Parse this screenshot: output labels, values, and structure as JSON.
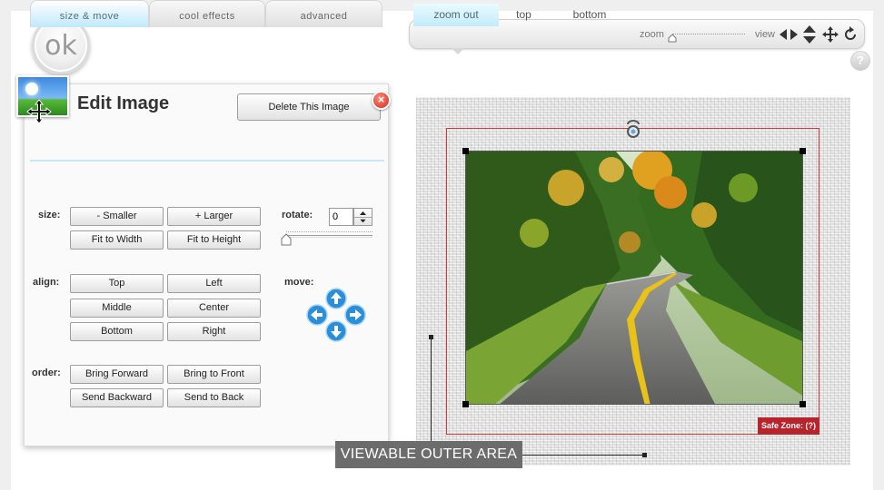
{
  "ok_button": {
    "label": "ok"
  },
  "toolbar": {
    "tabs": [
      "zoom out",
      "top",
      "bottom"
    ],
    "active_tab": "zoom out",
    "zoom_label": "zoom",
    "zoom_level": 0.0,
    "view_label": "view",
    "icons": [
      "left-right-arrows-icon",
      "up-down-arrows-icon",
      "move-icon",
      "rotate-icon"
    ],
    "help_label": "?"
  },
  "panel": {
    "title": "Edit Image",
    "delete_label": "Delete This Image",
    "close_label": "×",
    "tabs": [
      "size & move",
      "cool effects",
      "advanced"
    ],
    "active_tab": "size & move",
    "size": {
      "label": "size:",
      "buttons": [
        "- Smaller",
        "+ Larger",
        "Fit to Width",
        "Fit to Height"
      ]
    },
    "rotate": {
      "label": "rotate:",
      "value": "0"
    },
    "align": {
      "label": "align:",
      "buttons": [
        "Top",
        "Left",
        "Middle",
        "Center",
        "Bottom",
        "Right"
      ]
    },
    "move": {
      "label": "move:",
      "directions": [
        "up",
        "left",
        "right",
        "down"
      ]
    },
    "order": {
      "label": "order:",
      "buttons": [
        "Bring Forward",
        "Bring to Front",
        "Send Backward",
        "Send to Back"
      ]
    }
  },
  "canvas": {
    "safe_zone_label": "Safe Zone: (?)",
    "viewable_label": "VIEWABLE OUTER AREA"
  },
  "colors": {
    "accent_tab": "#bfe9fb",
    "safe_zone": "#d9363e",
    "safe_badge": "#b8242b",
    "label_bg": "#6c6c6c",
    "arrow_blue": "#2a8fd8"
  }
}
